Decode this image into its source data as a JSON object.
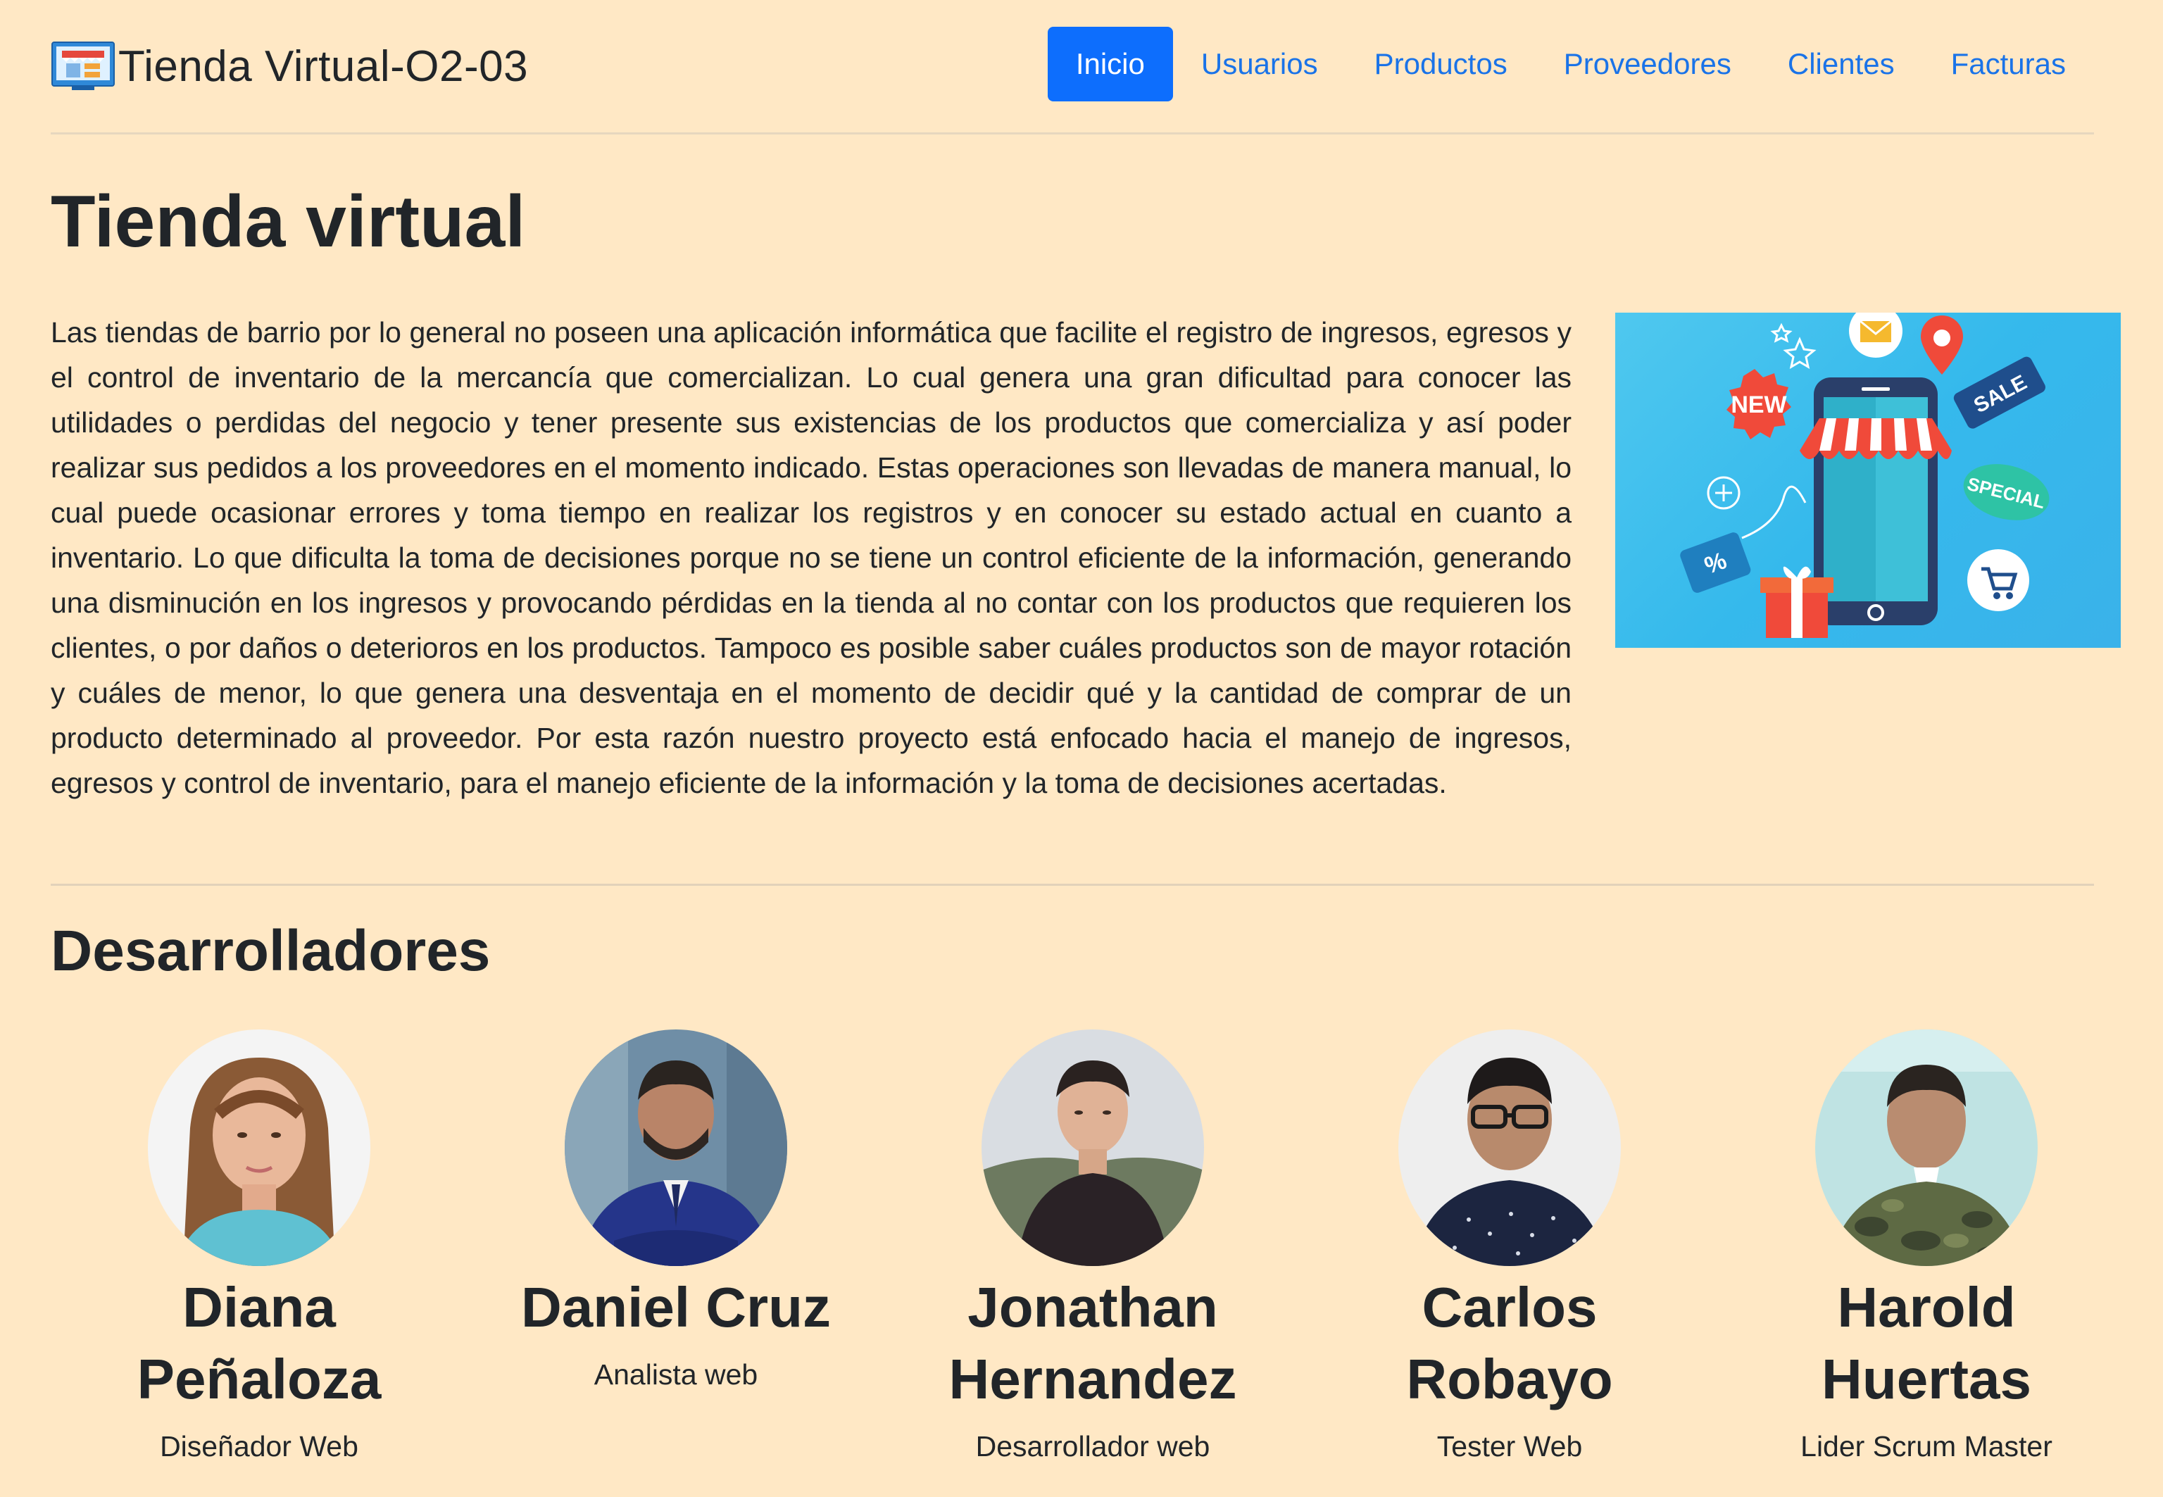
{
  "navbar": {
    "brand": "Tienda Virtual-O2-03",
    "links": [
      {
        "label": "Inicio",
        "active": true
      },
      {
        "label": "Usuarios",
        "active": false
      },
      {
        "label": "Productos",
        "active": false
      },
      {
        "label": "Proveedores",
        "active": false
      },
      {
        "label": "Clientes",
        "active": false
      },
      {
        "label": "Facturas",
        "active": false
      }
    ]
  },
  "hero": {
    "title": "Tienda virtual",
    "text": "Las tiendas de barrio por lo general no poseen una aplicación informática que facilite el registro de ingresos, egresos y el control de inventario de la mercancía que comercializan. Lo cual genera una gran dificultad para conocer las utilidades o perdidas del negocio y tener presente sus existencias de los productos que comercializa y así poder realizar sus pedidos a los proveedores en el momento indicado. Estas operaciones son llevadas de manera manual, lo cual puede ocasionar errores y toma tiempo en realizar los registros y en conocer su estado actual en cuanto a inventario. Lo que dificulta la toma de decisiones porque no se tiene un control eficiente de la información, generando una disminución en los ingresos y provocando pérdidas en la tienda al no contar con los productos que requieren los clientes, o por daños o deterioros en los productos. Tampoco es posible saber cuáles productos son de mayor rotación y cuáles de menor, lo que genera una desventaja en el momento de decidir qué y la cantidad de comprar de un producto determinado al proveedor. Por esta razón nuestro proyecto está enfocado hacia el manejo de ingresos, egresos y control de inventario, para el manejo eficiente de la información y la toma de decisiones acertadas.",
    "image": {
      "badge_new": "NEW",
      "badge_sale": "SALE",
      "badge_special": "SPECIAL",
      "badge_percent": "%"
    }
  },
  "developers": {
    "title": "Desarrolladores",
    "members": [
      {
        "name": "Diana Peñaloza",
        "role": "Diseñador Web"
      },
      {
        "name": "Daniel Cruz",
        "role": "Analista web"
      },
      {
        "name": "Jonathan Hernandez",
        "role": "Desarrollador web"
      },
      {
        "name": "Carlos Robayo",
        "role": "Tester Web"
      },
      {
        "name": "Harold Huertas",
        "role": "Lider Scrum Master"
      }
    ]
  },
  "colors": {
    "background": "#ffe8c5",
    "primary": "#0d6efd",
    "link": "#1a73e8",
    "text": "#212529"
  }
}
